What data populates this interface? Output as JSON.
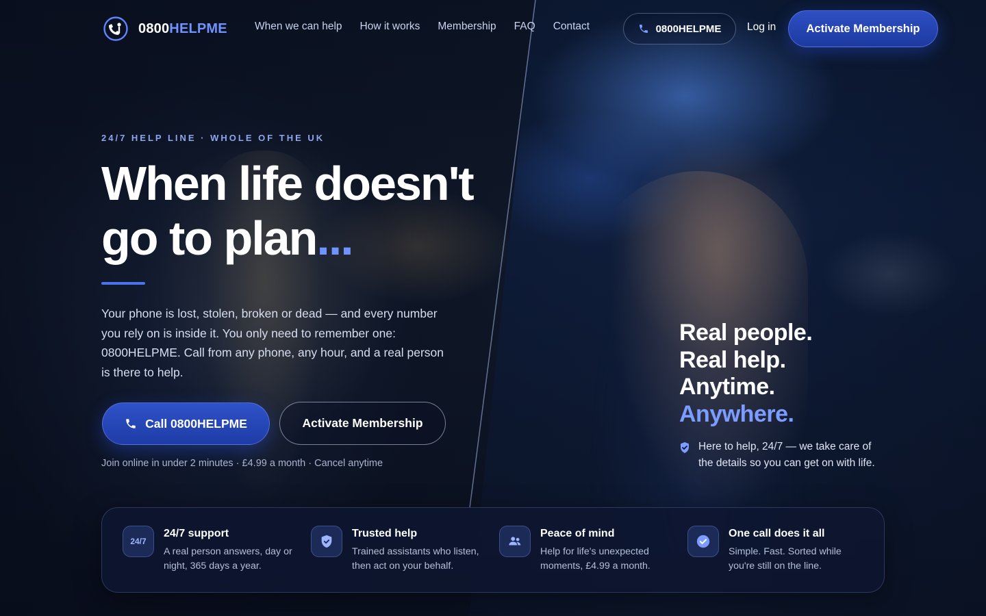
{
  "brand": {
    "part1": "0800",
    "part2": "HELPME"
  },
  "nav": {
    "links": [
      "When we can help",
      "How it works",
      "Membership",
      "FAQ",
      "Contact"
    ],
    "phone_label": "0800HELPME",
    "login": "Log in",
    "cta": "Activate Membership"
  },
  "hero": {
    "eyebrow": "24/7 HELP LINE · WHOLE OF THE UK",
    "title_line1": "When life doesn't",
    "title_line2": "go to plan",
    "title_dots": "...",
    "body": "Your phone is lost, stolen, broken or dead — and every number you rely on is inside it. You only need to remember one: 0800HELPME. Call from any phone, any hour, and a real person is there to help.",
    "call_button": "Call 0800HELPME",
    "activate_button": "Activate Membership",
    "fineprint": "Join online in under 2 minutes · £4.99 a month · Cancel anytime"
  },
  "tagline": {
    "line1": "Real people.",
    "line2": "Real help.",
    "line3": "Anytime.",
    "line4": "Anywhere.",
    "assurance": "Here to help, 24/7 — we take care of the details so you can get on with life."
  },
  "features": [
    {
      "icon": "24/7",
      "icon_name": "clock-247-icon",
      "title": "24/7 support",
      "desc": "A real person answers, day or night, 365 days a year."
    },
    {
      "icon": "",
      "icon_name": "shield-icon",
      "title": "Trusted help",
      "desc": "Trained assistants who listen, then act on your behalf."
    },
    {
      "icon": "",
      "icon_name": "people-icon",
      "title": "Peace of mind",
      "desc": "Help for life's unexpected moments, £4.99 a month."
    },
    {
      "icon": "",
      "icon_name": "check-circle-icon",
      "title": "One call does it all",
      "desc": "Simple. Fast. Sorted while you're still on the line."
    }
  ],
  "colors": {
    "accent": "#6f93ff",
    "button": "#2441b3",
    "panel": "#0e1630"
  }
}
